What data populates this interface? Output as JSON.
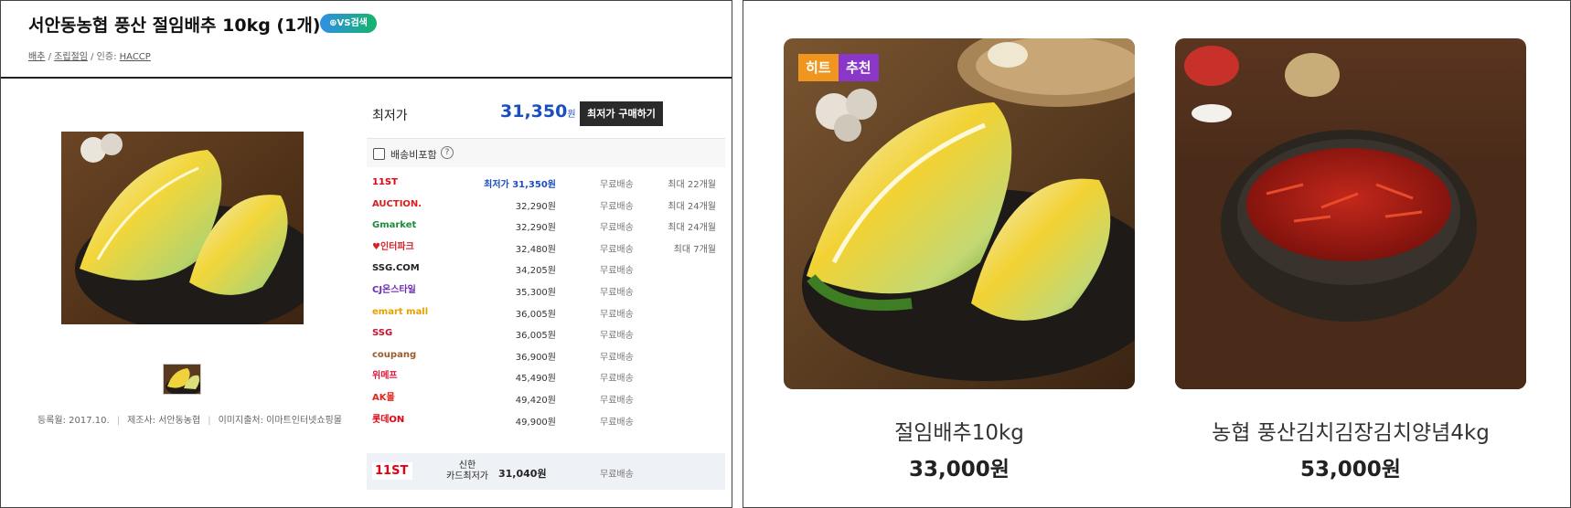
{
  "product": {
    "title": "서안동농협 풍산 절임배추 10kg (1개)",
    "vs_badge": "⊕VS검색",
    "breadcrumb": {
      "category": "배추",
      "sep1": " / ",
      "type": "조립절임",
      "sep2": " / 인증: ",
      "cert": "HACCP"
    },
    "meta": {
      "registered": "등록월: 2017.10.",
      "maker": "제조사: 서안동농협",
      "image_source": "이미지출처: 이마트인터넷쇼핑몰"
    }
  },
  "pricing": {
    "lowest_label": "최저가",
    "lowest_value": "31,350",
    "lowest_unit": "원",
    "buy_button": "최저가 구매하기",
    "shipping_included_label": "배송비포함",
    "help_icon_text": "?",
    "offers": [
      {
        "store": "11ST",
        "logo_color": "#e60012",
        "price": "최저가 31,350원",
        "shipping": "무료배송",
        "installment": "최대 22개월",
        "best": true
      },
      {
        "store": "AUCTION.",
        "logo_color": "#d81e1e",
        "price": "32,290원",
        "shipping": "무료배송",
        "installment": "최대 24개월",
        "best": false
      },
      {
        "store": "Gmarket",
        "logo_color": "#1a8c3a",
        "price": "32,290원",
        "shipping": "무료배송",
        "installment": "최대 24개월",
        "best": false
      },
      {
        "store": "♥인터파크",
        "logo_color": "#d8232a",
        "price": "32,480원",
        "shipping": "무료배송",
        "installment": "최대 7개월",
        "best": false
      },
      {
        "store": "SSG.COM",
        "logo_color": "#222222",
        "price": "34,205원",
        "shipping": "무료배송",
        "installment": "",
        "best": false
      },
      {
        "store": "CJ온스타일",
        "logo_color": "#6b2bb5",
        "price": "35,300원",
        "shipping": "무료배송",
        "installment": "",
        "best": false
      },
      {
        "store": "emart mall",
        "logo_color": "#e8a100",
        "price": "36,005원",
        "shipping": "무료배송",
        "installment": "",
        "best": false
      },
      {
        "store": "SSG",
        "logo_color": "#c8102e",
        "price": "36,005원",
        "shipping": "무료배송",
        "installment": "",
        "best": false
      },
      {
        "store": "coupang",
        "logo_color": "#9b5c2b",
        "price": "36,900원",
        "shipping": "무료배송",
        "installment": "",
        "best": false
      },
      {
        "store": "위메프",
        "logo_color": "#e4153b",
        "price": "45,490원",
        "shipping": "무료배송",
        "installment": "",
        "best": false
      },
      {
        "store": "AK몰",
        "logo_color": "#e2231a",
        "price": "49,420원",
        "shipping": "무료배송",
        "installment": "",
        "best": false
      },
      {
        "store": "롯데ON",
        "logo_color": "#e60012",
        "price": "49,900원",
        "shipping": "무료배송",
        "installment": "",
        "best": false
      }
    ],
    "card_offer": {
      "store": "11ST",
      "label_line1": "신한",
      "label_line2": "카드최저가",
      "price": "31,040원",
      "shipping": "무료배송"
    }
  },
  "recommendations": [
    {
      "name": "절임배추10kg",
      "price": "33,000원",
      "badges": [
        "히트",
        "추천"
      ]
    },
    {
      "name": "농협 풍산김치김장김치양념4kg",
      "price": "53,000원",
      "badges": []
    }
  ],
  "colors": {
    "accent_blue": "#1b4fbf",
    "badge_hit": "#f0961e",
    "badge_recommend": "#8a36c9"
  }
}
